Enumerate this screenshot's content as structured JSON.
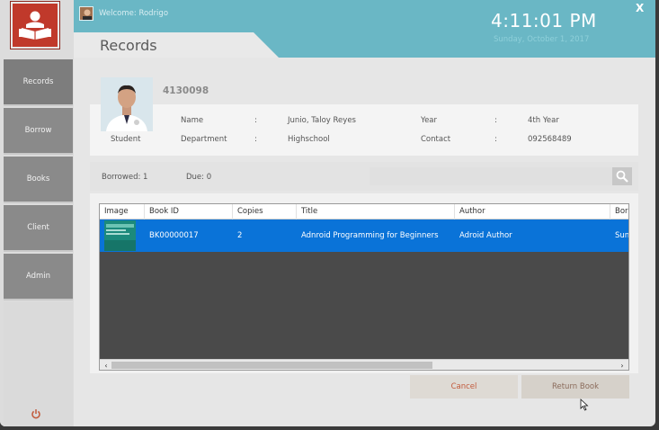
{
  "header": {
    "welcome": "Welcome: Rodrigo",
    "time": "4:11:01 PM",
    "date": "Sunday, October 1, 2017",
    "close_label": "X"
  },
  "sidebar": {
    "items": [
      {
        "label": "Records"
      },
      {
        "label": "Borrow"
      },
      {
        "label": "Books"
      },
      {
        "label": "Client"
      },
      {
        "label": "Admin"
      }
    ]
  },
  "page": {
    "title": "Records"
  },
  "student": {
    "id": "4130098",
    "role": "Student",
    "name_label": "Name",
    "name": "Junio, Taloy Reyes",
    "department_label": "Department",
    "department": "Highschool",
    "year_label": "Year",
    "year": "4th Year",
    "contact_label": "Contact",
    "contact": "092568489",
    "separator": ":"
  },
  "summary": {
    "borrowed": "Borrowed: 1",
    "due": "Due: 0",
    "search_value": ""
  },
  "table": {
    "columns": [
      "Image",
      "Book ID",
      "Copies",
      "Title",
      "Author",
      "Borr"
    ],
    "rows": [
      {
        "book_id": "BK00000017",
        "copies": "2",
        "title": "Adnroid Programming for Beginners",
        "author": "Adroid Author",
        "borrowed": "Sun"
      }
    ]
  },
  "buttons": {
    "cancel": "Cancel",
    "return": "Return Book"
  },
  "colors": {
    "header": "#6ab7c5",
    "accent_red": "#c0392b",
    "selection": "#0a73d8"
  }
}
